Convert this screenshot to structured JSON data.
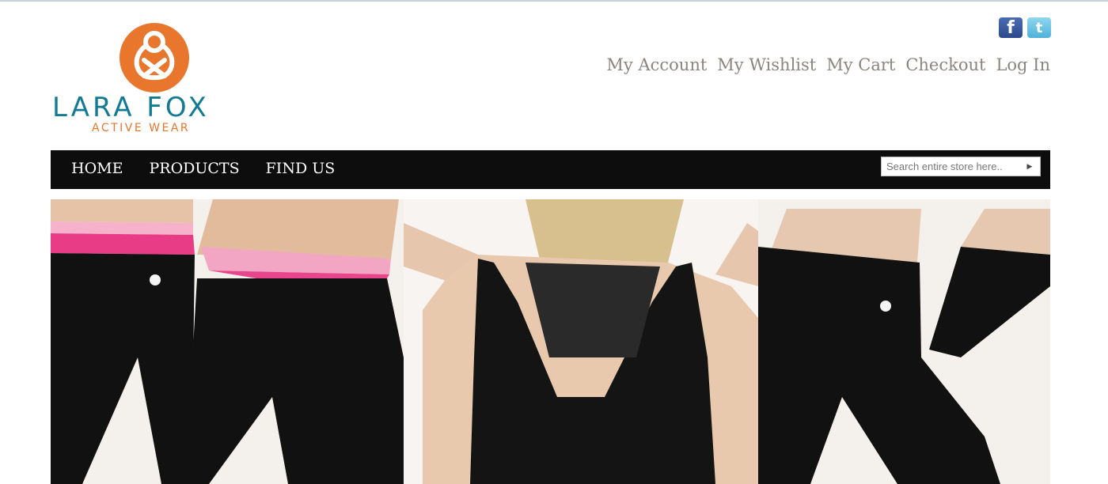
{
  "brand": {
    "name": "LARA FOX",
    "tagline": "ACTIVE WEAR",
    "colors": {
      "orange": "#e8762d",
      "teal": "#137a94"
    }
  },
  "social": {
    "facebook_glyph": "f",
    "twitter_glyph": "t",
    "icons": [
      "facebook-icon",
      "twitter-icon"
    ]
  },
  "account_links": [
    "My Account",
    "My Wishlist",
    "My Cart",
    "Checkout",
    "Log In"
  ],
  "nav": {
    "items": [
      "HOME",
      "PRODUCTS",
      "FIND US"
    ]
  },
  "search": {
    "placeholder": "Search entire store here..",
    "value": ""
  },
  "hero": {
    "images": [
      "black-leggings-pink-waistband",
      "black-mesh-back-tank-top",
      "black-leggings-side-view"
    ]
  }
}
